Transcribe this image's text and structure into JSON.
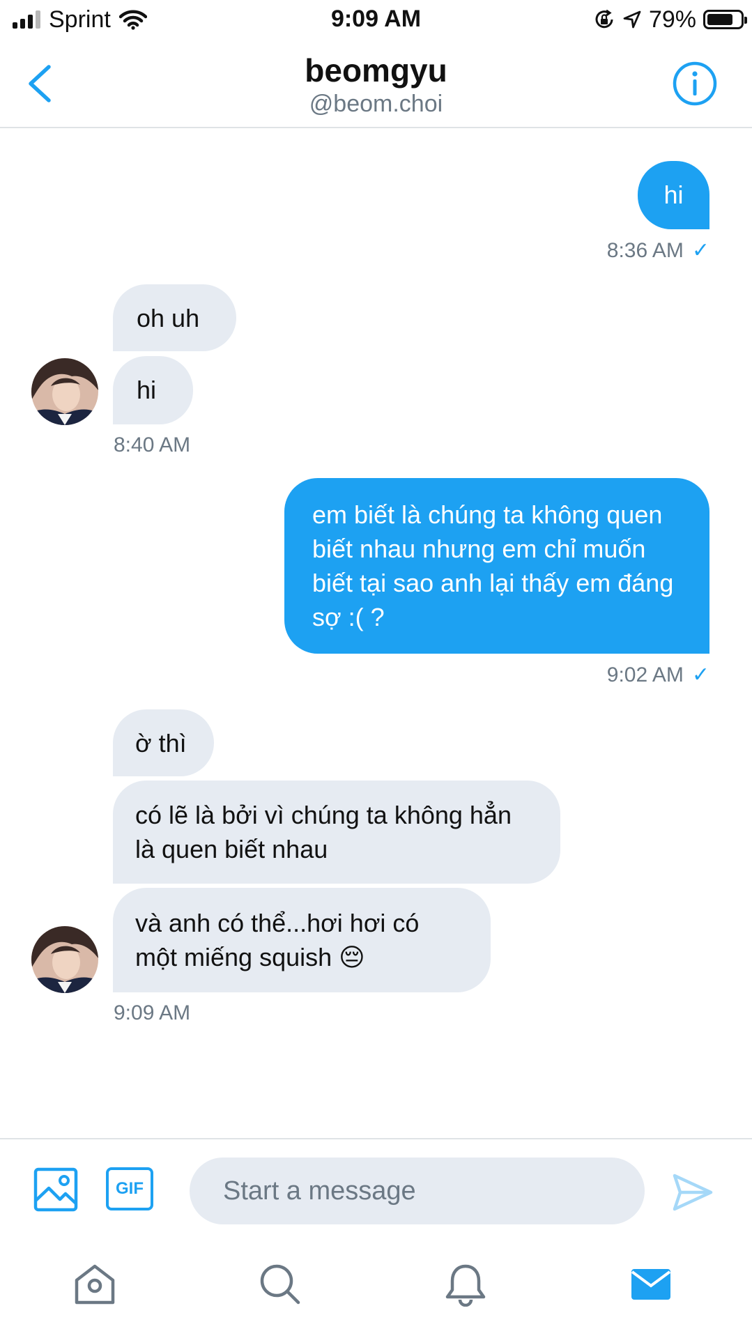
{
  "status_bar": {
    "carrier": "Sprint",
    "time": "9:09 AM",
    "battery_percent": "79%",
    "battery_level": 0.79,
    "icons": [
      "signal-icon",
      "wifi-icon",
      "orientation-lock-icon",
      "location-arrow-icon",
      "battery-icon"
    ]
  },
  "header": {
    "name": "beomgyu",
    "handle": "@beom.choi",
    "icons": [
      "back-chevron-icon",
      "info-icon"
    ]
  },
  "messages": [
    {
      "direction": "out",
      "text": "hi"
    },
    {
      "direction": "out",
      "time": "8:36 AM",
      "status_icon": "check-icon"
    },
    {
      "direction": "in",
      "text": "oh uh"
    },
    {
      "direction": "in",
      "text": "hi"
    },
    {
      "direction": "in",
      "time": "8:40 AM"
    },
    {
      "direction": "out",
      "text": "em biết là chúng ta không quen biết nhau nhưng em chỉ muốn biết tại sao anh lại thấy em đáng sợ :( ?"
    },
    {
      "direction": "out",
      "time": "9:02 AM",
      "status_icon": "check-icon"
    },
    {
      "direction": "in",
      "text": "ờ thì"
    },
    {
      "direction": "in",
      "text": "có lẽ là bởi vì chúng ta không hẳn là quen biết nhau"
    },
    {
      "direction": "in",
      "text": "và anh có thể...hơi hơi có một miếng squish 😔"
    },
    {
      "direction": "in",
      "time": "9:09 AM"
    }
  ],
  "composer": {
    "placeholder": "Start a message",
    "gif_label": "GIF",
    "icons": [
      "image-icon",
      "gif-icon",
      "send-icon"
    ]
  },
  "tab_bar": {
    "items": [
      "home-icon",
      "search-icon",
      "notifications-bell-icon",
      "messages-envelope-icon"
    ],
    "active": "messages-envelope-icon"
  },
  "colors": {
    "accent": "#1da1f2",
    "incoming_bubble": "#e6ebf2",
    "secondary_text": "#6b7884"
  }
}
